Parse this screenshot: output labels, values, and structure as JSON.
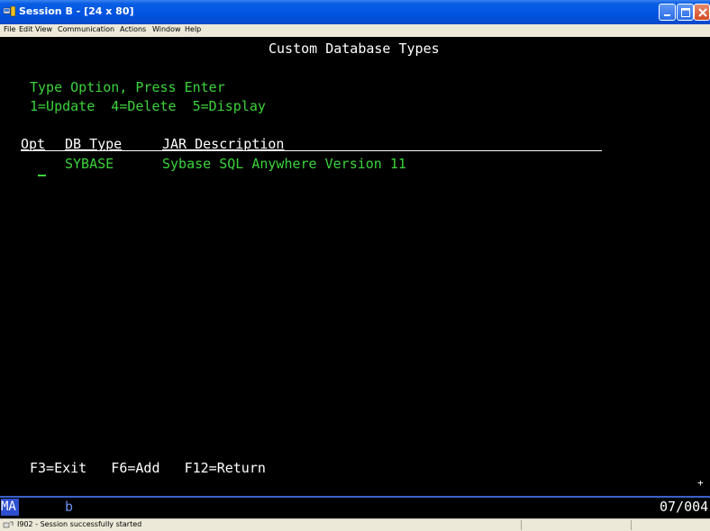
{
  "window": {
    "title": "Session B - [24 x 80]"
  },
  "menu": {
    "items": [
      "File",
      "Edit",
      "View",
      "Communication",
      "Actions",
      "Window",
      "Help"
    ]
  },
  "screen": {
    "title": "Custom Database Types",
    "instruction": "Type Option, Press Enter",
    "options": "1=Update  4=Delete  5=Display",
    "columns": {
      "opt": "Opt",
      "db_type": "DB Type",
      "jar_description": "JAR Description"
    },
    "rows": [
      {
        "opt": "_",
        "db_type": "SYBASE",
        "description": "Sybase SQL Anywhere Version 11"
      }
    ],
    "function_keys": "F3=Exit   F6=Add   F12=Return",
    "more_indicator": "+"
  },
  "oia": {
    "mode": "MA",
    "input_char": "b",
    "cursor_position": "07/004"
  },
  "status_bar": {
    "message": "I902 - Session successfully started"
  },
  "colors": {
    "titlebar": "#0053e0",
    "terminal_green": "#3bd43b",
    "terminal_bg": "#000000",
    "oia_mode_bg": "#2e4fd0"
  }
}
